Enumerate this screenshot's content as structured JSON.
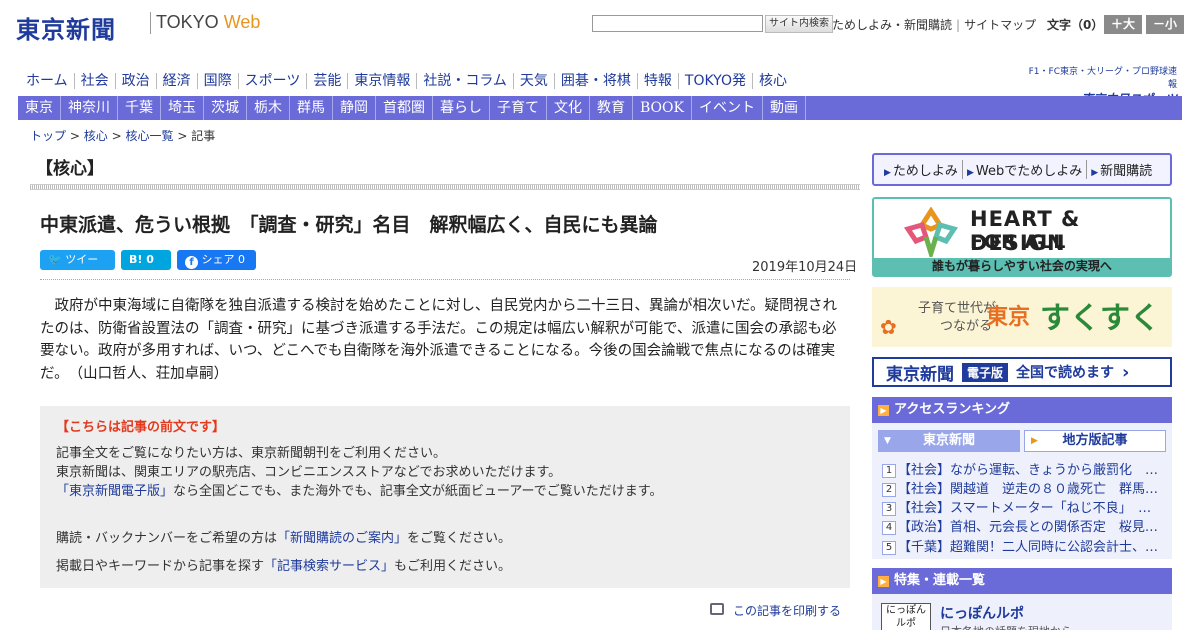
{
  "header": {
    "logo_jp": "東京新聞",
    "logo_en_tokyo": "TOKYO",
    "logo_en_web": "Web",
    "search_button": "サイト内検索",
    "search_value": "",
    "top_links": [
      "ためしよみ・新聞購読",
      "サイトマップ"
    ],
    "font_size_label": "文字（0）",
    "font_big": "＋大",
    "font_small": "－小"
  },
  "nav_primary": [
    "ホーム",
    "社会",
    "政治",
    "経済",
    "国際",
    "スポーツ",
    "芸能",
    "東京情報",
    "社説・コラム",
    "天気",
    "囲碁・将棋",
    "特報",
    "TOKYO発",
    "核心"
  ],
  "sports_logo": {
    "line1": "F1・FC東京・大リーグ・プロ野球速報",
    "line2": "東京中日スポーツ"
  },
  "nav_secondary": [
    "東京",
    "神奈川",
    "千葉",
    "埼玉",
    "茨城",
    "栃木",
    "群馬",
    "静岡",
    "首都圏",
    "暮らし",
    "子育て",
    "文化",
    "教育",
    "BOOK",
    "イベント",
    "動画"
  ],
  "breadcrumb": {
    "items": [
      "トップ",
      "核心",
      "核心一覧"
    ],
    "sep": ">",
    "current": "記事"
  },
  "article": {
    "section_title": "【核心】",
    "title": "中東派遣、危うい根拠　「調査・研究」名目　解釈幅広く、自民にも異論",
    "share": {
      "tweet": "ツイート",
      "hatena": "B!  0",
      "facebook": "シェア 0"
    },
    "date": "2019年10月24日",
    "lead": "政府が中東海域に自衛隊を独自派遣する検討を始めたことに対し、自民党内から二十三日、異論が相次いだ。疑問視されたのは、防衛省設置法の「調査・研究」に基づき派遣する手法だ。この規定は幅広い解釈が可能で、派遣に国会の承認も必要ない。政府が多用すれば、いつ、どこへでも自衛隊を海外派遣できることになる。今後の国会論戦で焦点になるのは確実だ。　（山口哲人、荘加卓嗣）"
  },
  "notice": {
    "head": "【こちらは記事の前文です】",
    "p1": "記事全文をご覧になりたい方は、東京新聞朝刊をご利用ください。",
    "p2": "東京新聞は、関東エリアの駅売店、コンビニエンスストアなどでお求めいただけます。",
    "p3_link": "「東京新聞電子版」",
    "p3_rest": "なら全国どこでも、また海外でも、記事全文が紙面ビューアーでご覧いただけます。",
    "p4_pre": "購読・バックナンバーをご希望の方は",
    "p4_link": "「新聞購読のご案内」",
    "p4_post": "をご覧ください。",
    "p5_pre": "掲載日やキーワードから記事を探す",
    "p5_link": "「記事検索サービス」",
    "p5_post": "もご利用ください。"
  },
  "print_link": "この記事を印刷する",
  "sidebar": {
    "subscribe_links": [
      "ためしよみ",
      "Webでためしよみ",
      "新聞購読"
    ],
    "heart_banner": {
      "line1": "HEART & DESIGN",
      "line2": "FOR ALL",
      "bar": "誰もが暮らしやすい社会の実現へ"
    },
    "sukusuku_banner": {
      "line1": "子育て世代が",
      "line2": "つながる",
      "line3": "東京",
      "line4": "すくすく"
    },
    "epaper_banner": {
      "logo": "東京新聞",
      "badge": "電子版",
      "text": "全国で読めます",
      "arrow": "›"
    },
    "ranking": {
      "head": "アクセスランキング",
      "tab_active": "東京新聞",
      "tab_other": "地方版記事",
      "items": [
        {
          "n": "1",
          "text": "【社会】ながら運転、きょうから厳罰化　…"
        },
        {
          "n": "2",
          "text": "【社会】関越道　逆走の８０歳死亡　群馬…"
        },
        {
          "n": "3",
          "text": "【社会】スマートメーター「ねじ不良」　…"
        },
        {
          "n": "4",
          "text": "【政治】首相、元会長との関係否定　桜見…"
        },
        {
          "n": "5",
          "text": "【千葉】超難関！二人同時に公認会計士、…"
        }
      ]
    },
    "series": {
      "head": "特集・連載一覧",
      "icon_text": "にっぽん ルポ",
      "title": "にっぽんルポ",
      "sub": "日本各地の話題を現地から"
    }
  }
}
